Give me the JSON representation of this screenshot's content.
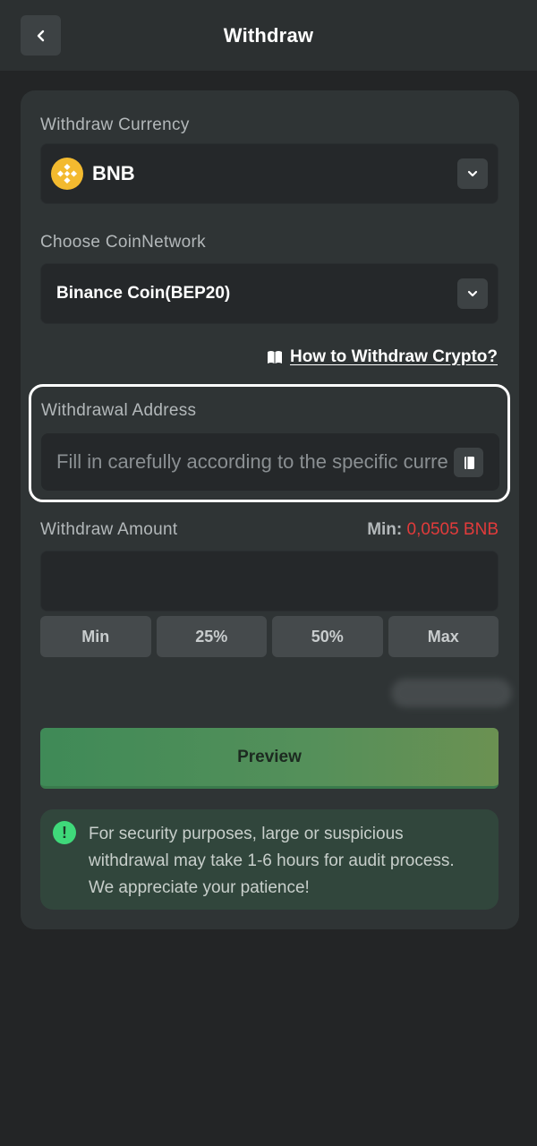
{
  "header": {
    "title": "Withdraw",
    "back_icon": "chevron-left-icon"
  },
  "currency": {
    "label": "Withdraw Currency",
    "selected": "BNB",
    "coin_color": "#f3ba2f"
  },
  "network": {
    "label": "Choose CoinNetwork",
    "selected": "Binance Coin(BEP20)"
  },
  "help_link": {
    "text": "How to Withdraw Crypto?",
    "icon": "book-icon"
  },
  "address": {
    "label": "Withdrawal Address",
    "placeholder": "Fill in carefully according to the specific currency",
    "value": ""
  },
  "amount": {
    "label": "Withdraw Amount",
    "min_prefix": "Min:",
    "min_value": "0,0505 BNB",
    "value": ""
  },
  "percent_buttons": [
    "Min",
    "25%",
    "50%",
    "Max"
  ],
  "preview_button": "Preview",
  "notice": {
    "icon": "exclamation-icon",
    "text": "For security purposes, large or suspicious withdrawal may take 1-6 hours for audit process. We appreciate your patience!"
  },
  "colors": {
    "background": "#232526",
    "card": "#2f3435",
    "accent_green": "#3fd97a",
    "min_red": "#e23b3b",
    "bnb_yellow": "#f3ba2f"
  }
}
